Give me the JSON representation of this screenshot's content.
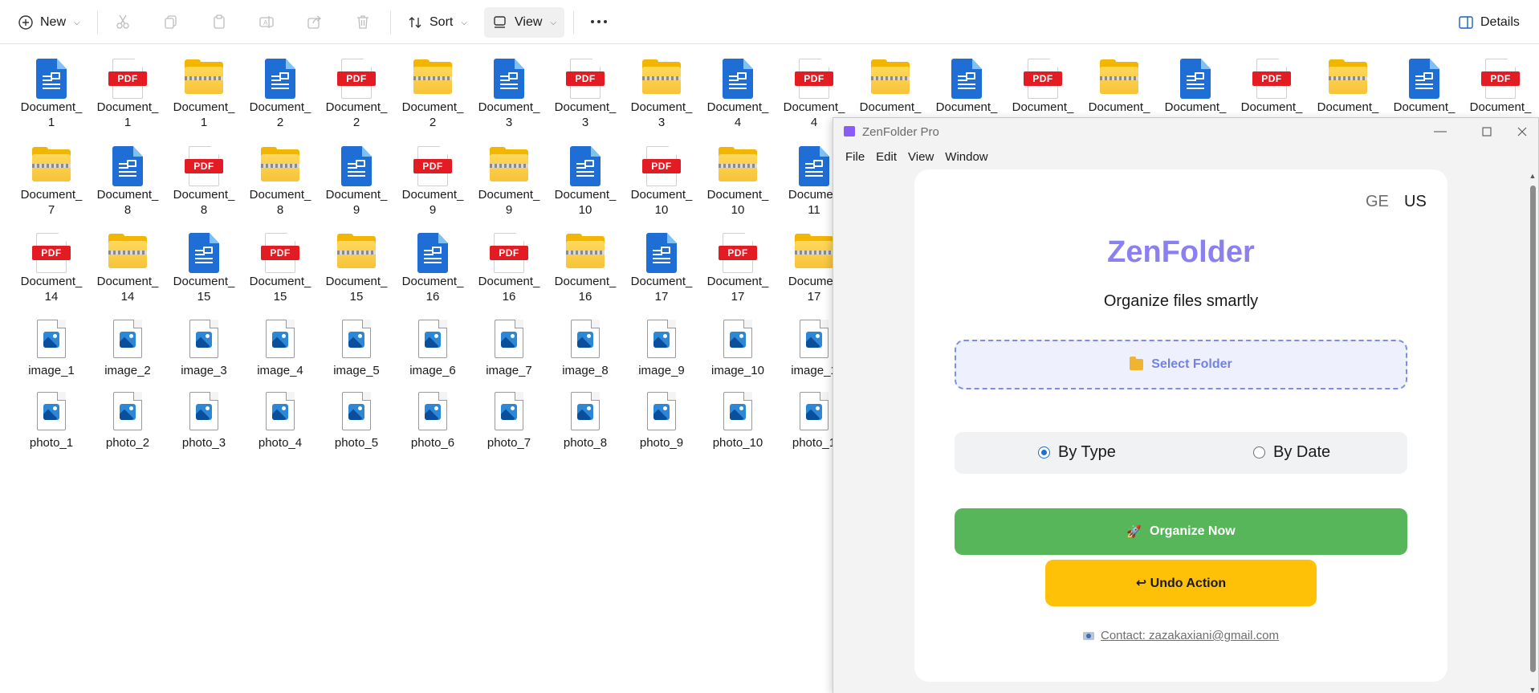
{
  "toolbar": {
    "new_label": "New",
    "sort_label": "Sort",
    "view_label": "View",
    "details_label": "Details"
  },
  "files": {
    "row1": [
      {
        "type": "doc",
        "name": [
          "Document_",
          "1"
        ]
      },
      {
        "type": "pdf",
        "name": [
          "Document_",
          "1"
        ]
      },
      {
        "type": "zip",
        "name": [
          "Document_",
          "1"
        ]
      },
      {
        "type": "doc",
        "name": [
          "Document_",
          "2"
        ]
      },
      {
        "type": "pdf",
        "name": [
          "Document_",
          "2"
        ]
      },
      {
        "type": "zip",
        "name": [
          "Document_",
          "2"
        ]
      },
      {
        "type": "doc",
        "name": [
          "Document_",
          "3"
        ]
      },
      {
        "type": "pdf",
        "name": [
          "Document_",
          "3"
        ]
      },
      {
        "type": "zip",
        "name": [
          "Document_",
          "3"
        ]
      },
      {
        "type": "doc",
        "name": [
          "Document_",
          "4"
        ]
      },
      {
        "type": "pdf",
        "name": [
          "Document_",
          "4"
        ]
      },
      {
        "type": "zip",
        "name": [
          "Document_",
          ""
        ]
      },
      {
        "type": "doc",
        "name": [
          "Document_",
          ""
        ]
      },
      {
        "type": "pdf",
        "name": [
          "Document_",
          ""
        ]
      },
      {
        "type": "zip",
        "name": [
          "Document_",
          ""
        ]
      },
      {
        "type": "doc",
        "name": [
          "Document_",
          ""
        ]
      },
      {
        "type": "pdf",
        "name": [
          "Document_",
          ""
        ]
      },
      {
        "type": "zip",
        "name": [
          "Document_",
          ""
        ]
      },
      {
        "type": "doc",
        "name": [
          "Document_",
          ""
        ]
      },
      {
        "type": "pdf",
        "name": [
          "Document_",
          ""
        ]
      }
    ],
    "row2": [
      {
        "type": "zip",
        "name": [
          "Document_",
          "7"
        ]
      },
      {
        "type": "doc",
        "name": [
          "Document_",
          "8"
        ]
      },
      {
        "type": "pdf",
        "name": [
          "Document_",
          "8"
        ]
      },
      {
        "type": "zip",
        "name": [
          "Document_",
          "8"
        ]
      },
      {
        "type": "doc",
        "name": [
          "Document_",
          "9"
        ]
      },
      {
        "type": "pdf",
        "name": [
          "Document_",
          "9"
        ]
      },
      {
        "type": "zip",
        "name": [
          "Document_",
          "9"
        ]
      },
      {
        "type": "doc",
        "name": [
          "Document_",
          "10"
        ]
      },
      {
        "type": "pdf",
        "name": [
          "Document_",
          "10"
        ]
      },
      {
        "type": "zip",
        "name": [
          "Document_",
          "10"
        ]
      },
      {
        "type": "doc",
        "name": [
          "Documen",
          "11"
        ]
      }
    ],
    "row3": [
      {
        "type": "pdf",
        "name": [
          "Document_",
          "14"
        ]
      },
      {
        "type": "zip",
        "name": [
          "Document_",
          "14"
        ]
      },
      {
        "type": "doc",
        "name": [
          "Document_",
          "15"
        ]
      },
      {
        "type": "pdf",
        "name": [
          "Document_",
          "15"
        ]
      },
      {
        "type": "zip",
        "name": [
          "Document_",
          "15"
        ]
      },
      {
        "type": "doc",
        "name": [
          "Document_",
          "16"
        ]
      },
      {
        "type": "pdf",
        "name": [
          "Document_",
          "16"
        ]
      },
      {
        "type": "zip",
        "name": [
          "Document_",
          "16"
        ]
      },
      {
        "type": "doc",
        "name": [
          "Document_",
          "17"
        ]
      },
      {
        "type": "pdf",
        "name": [
          "Document_",
          "17"
        ]
      },
      {
        "type": "zip",
        "name": [
          "Documen",
          "17"
        ]
      }
    ],
    "row4": [
      "image_1",
      "image_2",
      "image_3",
      "image_4",
      "image_5",
      "image_6",
      "image_7",
      "image_8",
      "image_9",
      "image_10",
      "image_1"
    ],
    "row5": [
      "photo_1",
      "photo_2",
      "photo_3",
      "photo_4",
      "photo_5",
      "photo_6",
      "photo_7",
      "photo_8",
      "photo_9",
      "photo_10",
      "photo_1"
    ]
  },
  "zenfolder": {
    "window_title": "ZenFolder Pro",
    "menu": [
      "File",
      "Edit",
      "View",
      "Window"
    ],
    "lang_ge": "GE",
    "lang_us": "US",
    "brand": "ZenFolder",
    "tagline": "Organize files smartly",
    "select_folder": "Select Folder",
    "by_type": "By Type",
    "by_date": "By Date",
    "selected_mode": "By Type",
    "organize": "Organize Now",
    "undo": "↩ Undo Action",
    "contact": "Contact: zazakaxiani@gmail.com",
    "colors": {
      "brand": "#8a80f0",
      "organize_bg": "#58b65a",
      "undo_bg": "#ffc107",
      "select_border": "#7b8fe8"
    }
  }
}
